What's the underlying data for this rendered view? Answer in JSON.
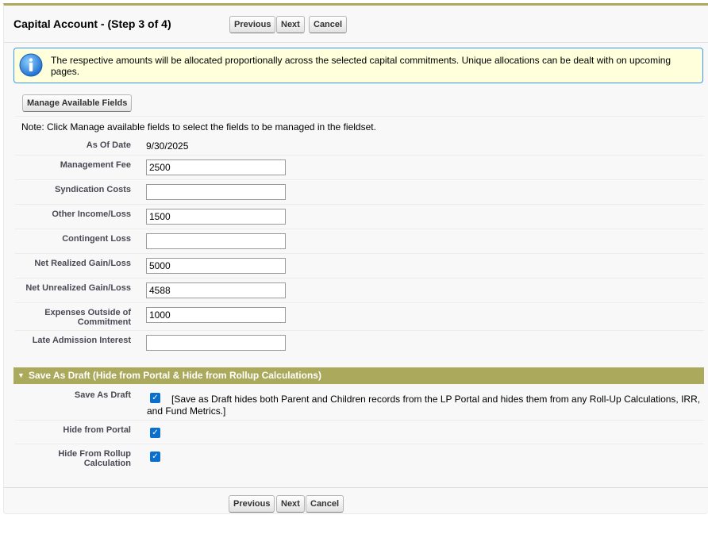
{
  "header": {
    "title": "Capital Account - (Step 3 of 4)",
    "previous_label": "Previous",
    "next_label": "Next",
    "cancel_label": "Cancel"
  },
  "info": {
    "icon": "info-icon",
    "message": "The respective amounts will be allocated proportionally across the selected capital commitments. Unique allocations can be dealt with on upcoming pages."
  },
  "manage_button_label": "Manage Available Fields",
  "note": "Note: Click Manage available fields to select the fields to be managed in the fieldset.",
  "fields": {
    "as_of_date": {
      "label": "As Of Date",
      "value": "9/30/2025"
    },
    "management_fee": {
      "label": "Management Fee",
      "value": "2500"
    },
    "syndication_costs": {
      "label": "Syndication Costs",
      "value": ""
    },
    "other_income_loss": {
      "label": "Other Income/Loss",
      "value": "1500"
    },
    "contingent_loss": {
      "label": "Contingent Loss",
      "value": ""
    },
    "net_realized_gain_loss": {
      "label": "Net Realized Gain/Loss",
      "value": "5000"
    },
    "net_unrealized_gain_loss": {
      "label": "Net Unrealized Gain/Loss",
      "value": "4588"
    },
    "expenses_outside_line1": "Expenses Outside of",
    "expenses_outside_line2": "Commitment",
    "expenses_outside_commitment": {
      "value": "1000"
    },
    "late_admission_interest": {
      "label": "Late Admission Interest",
      "value": ""
    }
  },
  "draft_section": {
    "title": "Save As Draft (Hide from Portal & Hide from Rollup Calculations)",
    "save_as_draft": {
      "label": "Save As Draft",
      "checked": true,
      "help": "[Save as Draft hides both Parent and Children records from the LP Portal and hides them from any Roll-Up Calculations, IRR, and Fund Metrics.]"
    },
    "hide_from_portal": {
      "label": "Hide from Portal",
      "checked": true
    },
    "hide_from_rollup_line1": "Hide From Rollup",
    "hide_from_rollup_line2": "Calculation",
    "hide_from_rollup": {
      "checked": true
    }
  },
  "footer": {
    "previous_label": "Previous",
    "next_label": "Next",
    "cancel_label": "Cancel"
  },
  "colors": {
    "accent": "#aaa95c",
    "info_border": "#3399ff",
    "info_background": "#ffffdc",
    "checkbox": "#0b6fce"
  }
}
